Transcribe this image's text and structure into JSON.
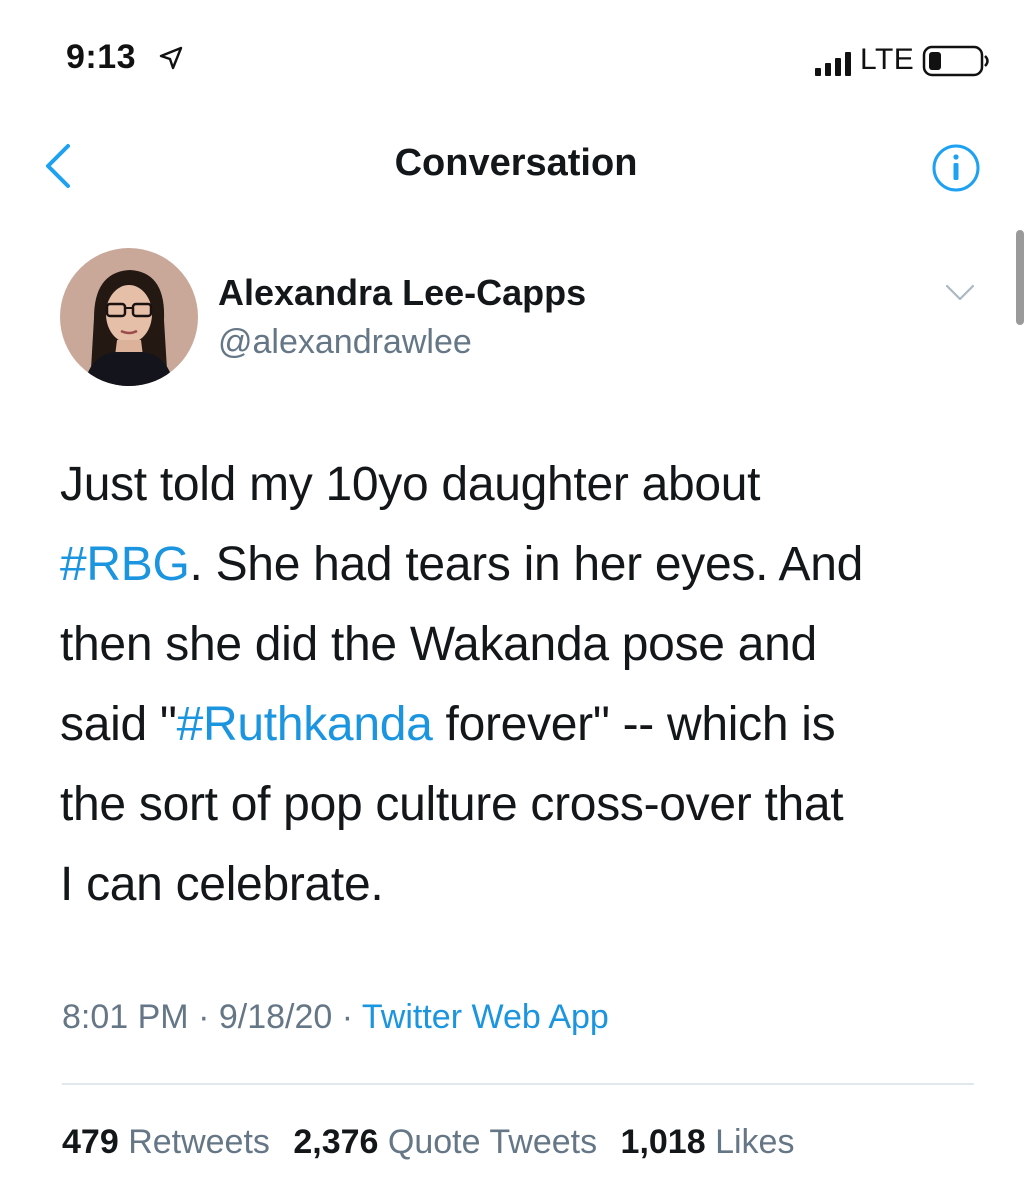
{
  "status_bar": {
    "time": "9:13",
    "network": "LTE"
  },
  "nav": {
    "title": "Conversation"
  },
  "tweet": {
    "author": {
      "display_name": "Alexandra Lee-Capps",
      "handle": "@alexandrawlee"
    },
    "lines": {
      "l1": "Just told my 10yo daughter about",
      "l2_tag": "#RBG",
      "l2_rest": ". She had tears in her eyes. And",
      "l3": "then she did the Wakanda pose and",
      "l4_pre": "said \"",
      "l4_tag": "#Ruthkanda",
      "l4_rest": " forever\" -- which is",
      "l5": "the sort of pop culture cross-over that",
      "l6": "I can celebrate."
    },
    "time": "8:01 PM",
    "date": "9/18/20",
    "source": "Twitter Web App",
    "separator": " · "
  },
  "stats": {
    "retweets_count": "479",
    "retweets_label": "Retweets",
    "quotes_count": "2,376",
    "quotes_label": "Quote Tweets",
    "likes_count": "1,018",
    "likes_label": "Likes"
  },
  "colors": {
    "link": "#1b95e0",
    "secondary_text": "#657786",
    "primary_text": "#14171a",
    "divider": "#e1e8ed"
  },
  "icons": {
    "back": "chevron-left-icon",
    "info": "info-icon",
    "location": "location-arrow-icon",
    "signal": "signal-bars-icon",
    "battery": "battery-icon",
    "caret": "chevron-down-icon"
  }
}
